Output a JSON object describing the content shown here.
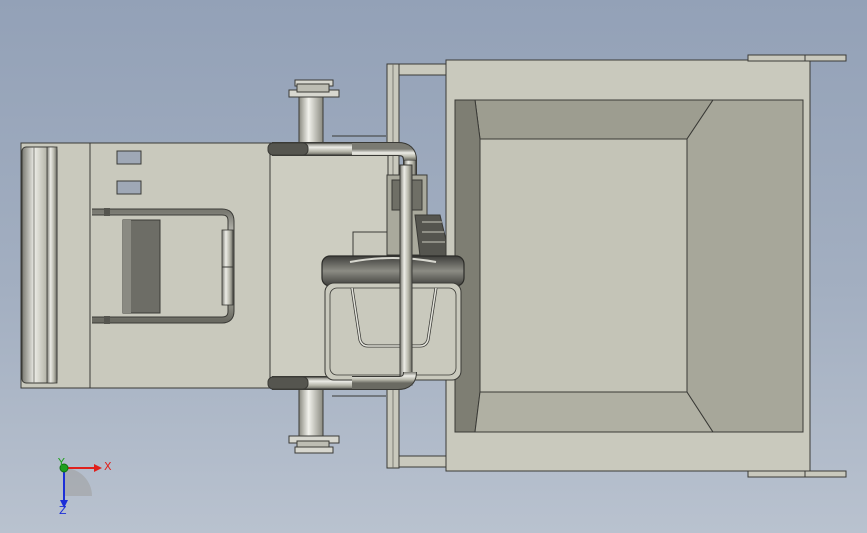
{
  "viewport": {
    "background_top": "#93a1b7",
    "background_bottom": "#b9c2cf"
  },
  "colors": {
    "part_fill": "#c9c9bd",
    "part_fill_dark": "#a9a99c",
    "hopper_inner": "#b4b4a6",
    "hopper_deep": "#8e8e82",
    "edge": "#3a3a36",
    "tube_light": "#e4e4dc",
    "tube_mid": "#b2b2a6",
    "tube_dark": "#6c6c64",
    "wheel_dark": "#4b4b47",
    "axis_x": "#e0201c",
    "axis_y": "#1ea01e",
    "axis_z": "#1c2fd8"
  },
  "triad": {
    "x_label": "X",
    "y_label": "Y",
    "z_label": "Z"
  },
  "icons": [
    "coordinate-triad-icon"
  ]
}
